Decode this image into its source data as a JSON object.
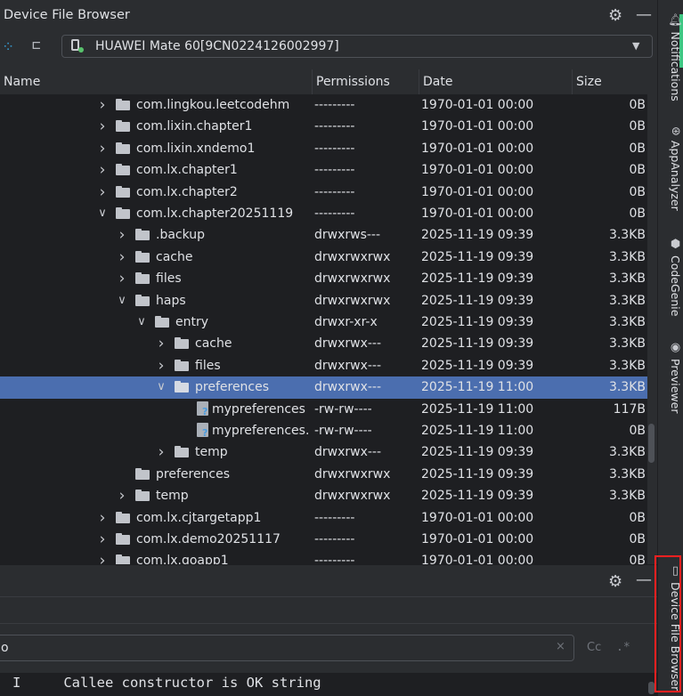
{
  "window": {
    "title": "Device File Browser"
  },
  "toolbar": {
    "device": "HUAWEI Mate 60[9CN0224126002997]"
  },
  "table": {
    "columns": {
      "name": "Name",
      "permissions": "Permissions",
      "date": "Date",
      "size": "Size"
    },
    "rows": [
      {
        "name": "com.lingkou.leetcodehm",
        "perm": "---------",
        "date": "1970-01-01 00:00",
        "size": "0B",
        "kind": "folder",
        "depth": 0,
        "expanded": false
      },
      {
        "name": "com.lixin.chapter1",
        "perm": "---------",
        "date": "1970-01-01 00:00",
        "size": "0B",
        "kind": "folder",
        "depth": 0,
        "expanded": false
      },
      {
        "name": "com.lixin.xndemo1",
        "perm": "---------",
        "date": "1970-01-01 00:00",
        "size": "0B",
        "kind": "folder",
        "depth": 0,
        "expanded": false
      },
      {
        "name": "com.lx.chapter1",
        "perm": "---------",
        "date": "1970-01-01 00:00",
        "size": "0B",
        "kind": "folder",
        "depth": 0,
        "expanded": false
      },
      {
        "name": "com.lx.chapter2",
        "perm": "---------",
        "date": "1970-01-01 00:00",
        "size": "0B",
        "kind": "folder",
        "depth": 0,
        "expanded": false
      },
      {
        "name": "com.lx.chapter20251119",
        "perm": "---------",
        "date": "1970-01-01 00:00",
        "size": "0B",
        "kind": "folder",
        "depth": 0,
        "expanded": true
      },
      {
        "name": ".backup",
        "perm": "drwxrws---",
        "date": "2025-11-19 09:39",
        "size": "3.3KB",
        "kind": "folder",
        "depth": 1,
        "expanded": false
      },
      {
        "name": "cache",
        "perm": "drwxrwxrwx",
        "date": "2025-11-19 09:39",
        "size": "3.3KB",
        "kind": "folder",
        "depth": 1,
        "expanded": false
      },
      {
        "name": "files",
        "perm": "drwxrwxrwx",
        "date": "2025-11-19 09:39",
        "size": "3.3KB",
        "kind": "folder",
        "depth": 1,
        "expanded": false
      },
      {
        "name": "haps",
        "perm": "drwxrwxrwx",
        "date": "2025-11-19 09:39",
        "size": "3.3KB",
        "kind": "folder",
        "depth": 1,
        "expanded": true
      },
      {
        "name": "entry",
        "perm": "drwxr-xr-x",
        "date": "2025-11-19 09:39",
        "size": "3.3KB",
        "kind": "folder",
        "depth": 2,
        "expanded": true
      },
      {
        "name": "cache",
        "perm": "drwxrwx---",
        "date": "2025-11-19 09:39",
        "size": "3.3KB",
        "kind": "folder",
        "depth": 3,
        "expanded": false
      },
      {
        "name": "files",
        "perm": "drwxrwx---",
        "date": "2025-11-19 09:39",
        "size": "3.3KB",
        "kind": "folder",
        "depth": 3,
        "expanded": false
      },
      {
        "name": "preferences",
        "perm": "drwxrwx---",
        "date": "2025-11-19 11:00",
        "size": "3.3KB",
        "kind": "folder",
        "depth": 3,
        "expanded": true,
        "selected": true
      },
      {
        "name": "mypreferences",
        "perm": "-rw-rw----",
        "date": "2025-11-19 11:00",
        "size": "117B",
        "kind": "file",
        "depth": 4
      },
      {
        "name": "mypreferences.",
        "perm": "-rw-rw----",
        "date": "2025-11-19 11:00",
        "size": "0B",
        "kind": "file",
        "depth": 4
      },
      {
        "name": "temp",
        "perm": "drwxrwx---",
        "date": "2025-11-19 09:39",
        "size": "3.3KB",
        "kind": "folder",
        "depth": 3,
        "expanded": false
      },
      {
        "name": "preferences",
        "perm": "drwxrwxrwx",
        "date": "2025-11-19 09:39",
        "size": "3.3KB",
        "kind": "folder",
        "depth": 1,
        "leaf": true
      },
      {
        "name": "temp",
        "perm": "drwxrwxrwx",
        "date": "2025-11-19 09:39",
        "size": "3.3KB",
        "kind": "folder",
        "depth": 1,
        "expanded": false
      },
      {
        "name": "com.lx.cjtargetapp1",
        "perm": "---------",
        "date": "1970-01-01 00:00",
        "size": "0B",
        "kind": "folder",
        "depth": 0,
        "expanded": false
      },
      {
        "name": "com.lx.demo20251117",
        "perm": "---------",
        "date": "1970-01-01 00:00",
        "size": "0B",
        "kind": "folder",
        "depth": 0,
        "expanded": false
      },
      {
        "name": "com.lx.goapp1",
        "perm": "---------",
        "date": "1970-01-01 00:00",
        "size": "0B",
        "kind": "folder",
        "depth": 0,
        "expanded": false
      }
    ]
  },
  "log": {
    "filter_value": "o",
    "clear_glyph": "×",
    "case_label": "Cc",
    "regex_label": ".*",
    "line_level": "I",
    "line_text": "Callee constructor is OK string"
  },
  "tool_windows": [
    {
      "label": "Notifications",
      "icon": "bell-icon"
    },
    {
      "label": "AppAnalyzer",
      "icon": "app-analyzer-icon"
    },
    {
      "label": "CodeGenie",
      "icon": "codegenie-icon"
    },
    {
      "label": "Previewer",
      "icon": "eye-icon"
    },
    {
      "label": "Device File Browser",
      "icon": "device-icon"
    }
  ],
  "colors": {
    "selection": "#4b6eaf",
    "highlight_box": "#ff2020",
    "online_dot": "#58c26c",
    "accent_green": "#3ec783"
  }
}
